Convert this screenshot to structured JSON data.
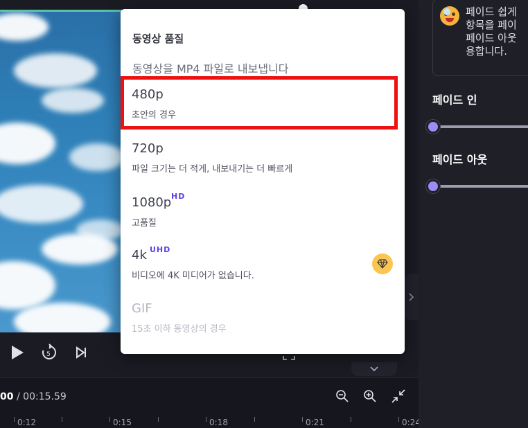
{
  "menu": {
    "title": "동영상 품질",
    "subtitle": "동영상을 MP4 파일로 내보냅니다",
    "options": [
      {
        "label": "480p",
        "desc": "초안의 경우",
        "badge": "",
        "disabled": false,
        "selected_highlight": true
      },
      {
        "label": "720p",
        "desc": "파일 크기는 더 적게, 내보내기는 더 빠르게",
        "badge": "",
        "disabled": false
      },
      {
        "label": "1080p",
        "desc": "고품질",
        "badge": "HD",
        "disabled": false
      },
      {
        "label": "4k",
        "desc": "비디오에 4K 미디어가 없습니다.",
        "badge": "UHD",
        "disabled": false,
        "premium": true
      },
      {
        "label": "GIF",
        "desc": "15초 이하 동영상의 경우",
        "badge": "",
        "disabled": true
      }
    ]
  },
  "timeline": {
    "current_time": "00",
    "total_time": "/ 00:15.59",
    "ticks": [
      "0:12",
      "0:15",
      "0:18",
      "0:21",
      "0:24"
    ]
  },
  "right_panel": {
    "tip_text": "페이드 쉽게\n항목을 페이\n페이드 아웃\n용합니다.",
    "fade_in_label": "페이드 인",
    "fade_out_label": "페이드 아웃",
    "fade_in_value": 0,
    "fade_out_value": 0
  },
  "colors": {
    "accent": "#9c8cf4",
    "badge": "#5a40e8",
    "premium": "#fbc64f",
    "highlight": "#ee1111"
  },
  "icons": {
    "play": "play-icon",
    "replay": "replay-5-icon",
    "skip": "skip-end-icon",
    "zoom_out": "zoom-out-icon",
    "zoom_in": "zoom-in-icon",
    "fit": "collapse-arrows-icon",
    "premium": "diamond-icon"
  }
}
